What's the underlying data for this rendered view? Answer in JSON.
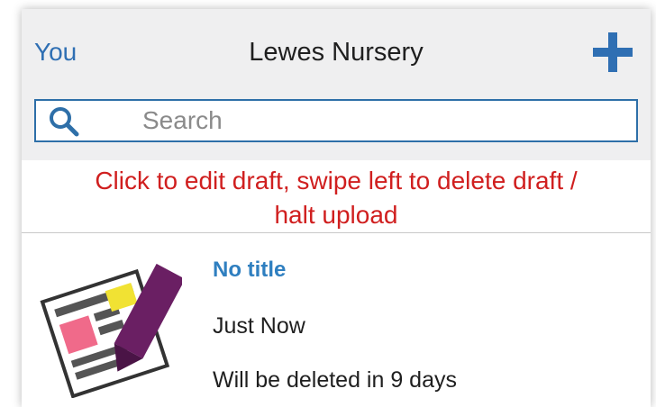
{
  "header": {
    "back_label": "You",
    "title": "Lewes Nursery",
    "add_icon": "plus-icon",
    "accent_color": "#2f6fb3"
  },
  "search": {
    "placeholder": "Search",
    "value": "",
    "icon": "search-icon"
  },
  "hint": {
    "line1": "Click to edit draft, swipe left to delete draft /",
    "line2": "halt upload",
    "color": "#d01f1f"
  },
  "drafts": [
    {
      "icon": "draft-document-icon",
      "title": "No title",
      "time": "Just Now",
      "expiry": "Will be deleted in 9 days"
    }
  ]
}
